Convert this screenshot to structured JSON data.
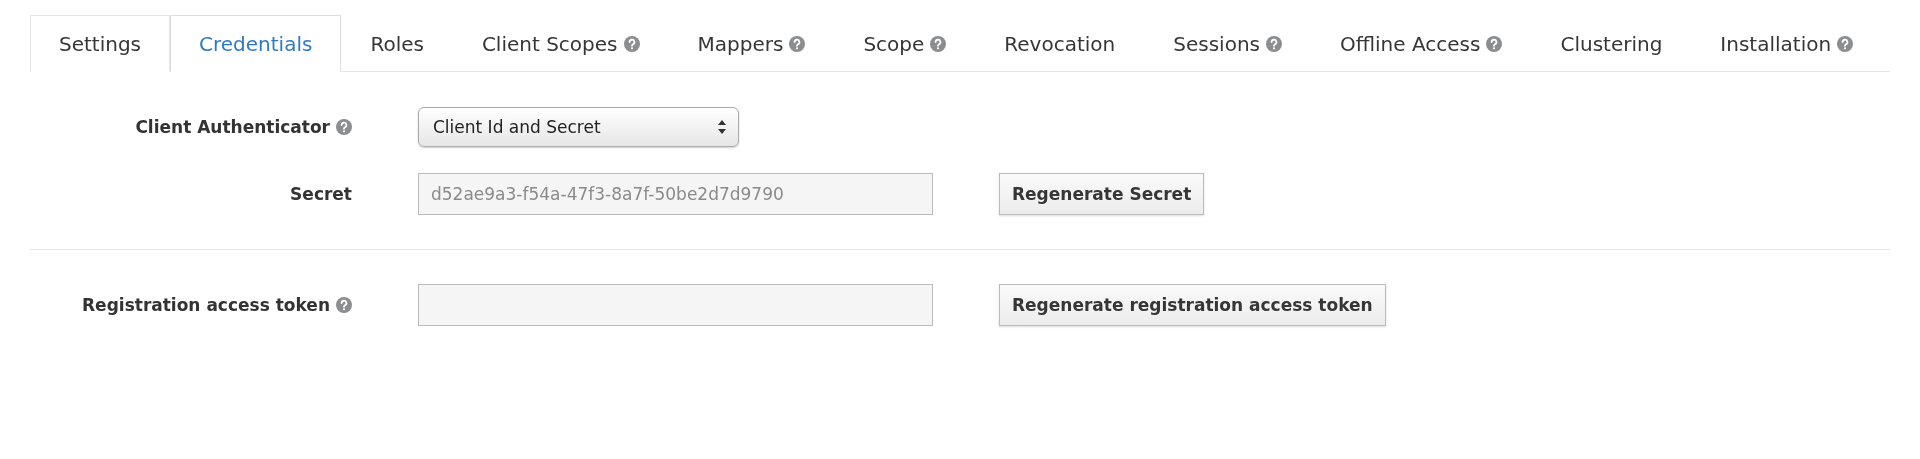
{
  "tabs": [
    {
      "label": "Settings",
      "selected": false,
      "help": false
    },
    {
      "label": "Credentials",
      "selected": true,
      "help": false
    },
    {
      "label": "Roles",
      "selected": false,
      "help": false
    },
    {
      "label": "Client Scopes",
      "selected": false,
      "help": true
    },
    {
      "label": "Mappers",
      "selected": false,
      "help": true
    },
    {
      "label": "Scope",
      "selected": false,
      "help": true
    },
    {
      "label": "Revocation",
      "selected": false,
      "help": false
    },
    {
      "label": "Sessions",
      "selected": false,
      "help": true
    },
    {
      "label": "Offline Access",
      "selected": false,
      "help": true
    },
    {
      "label": "Clustering",
      "selected": false,
      "help": false
    },
    {
      "label": "Installation",
      "selected": false,
      "help": true
    }
  ],
  "sections": [
    {
      "rows": [
        {
          "kind": "select",
          "label": "Client Authenticator",
          "help": true,
          "value": "Client Id and Secret"
        },
        {
          "kind": "input",
          "label": "Secret",
          "help": false,
          "value": "d52ae9a3-f54a-47f3-8a7f-50be2d7d9790",
          "button": "Regenerate Secret"
        }
      ]
    },
    {
      "rows": [
        {
          "kind": "input",
          "label": "Registration access token",
          "help": true,
          "button": "Regenerate registration access token"
        }
      ]
    }
  ]
}
